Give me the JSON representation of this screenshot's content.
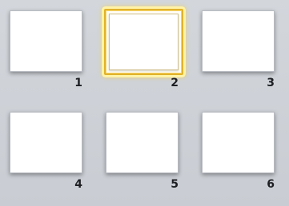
{
  "layout_gallery": {
    "items": [
      {
        "label": "1",
        "selected": false
      },
      {
        "label": "2",
        "selected": true
      },
      {
        "label": "3",
        "selected": false
      },
      {
        "label": "4",
        "selected": false
      },
      {
        "label": "5",
        "selected": false
      },
      {
        "label": "6",
        "selected": false
      }
    ]
  }
}
